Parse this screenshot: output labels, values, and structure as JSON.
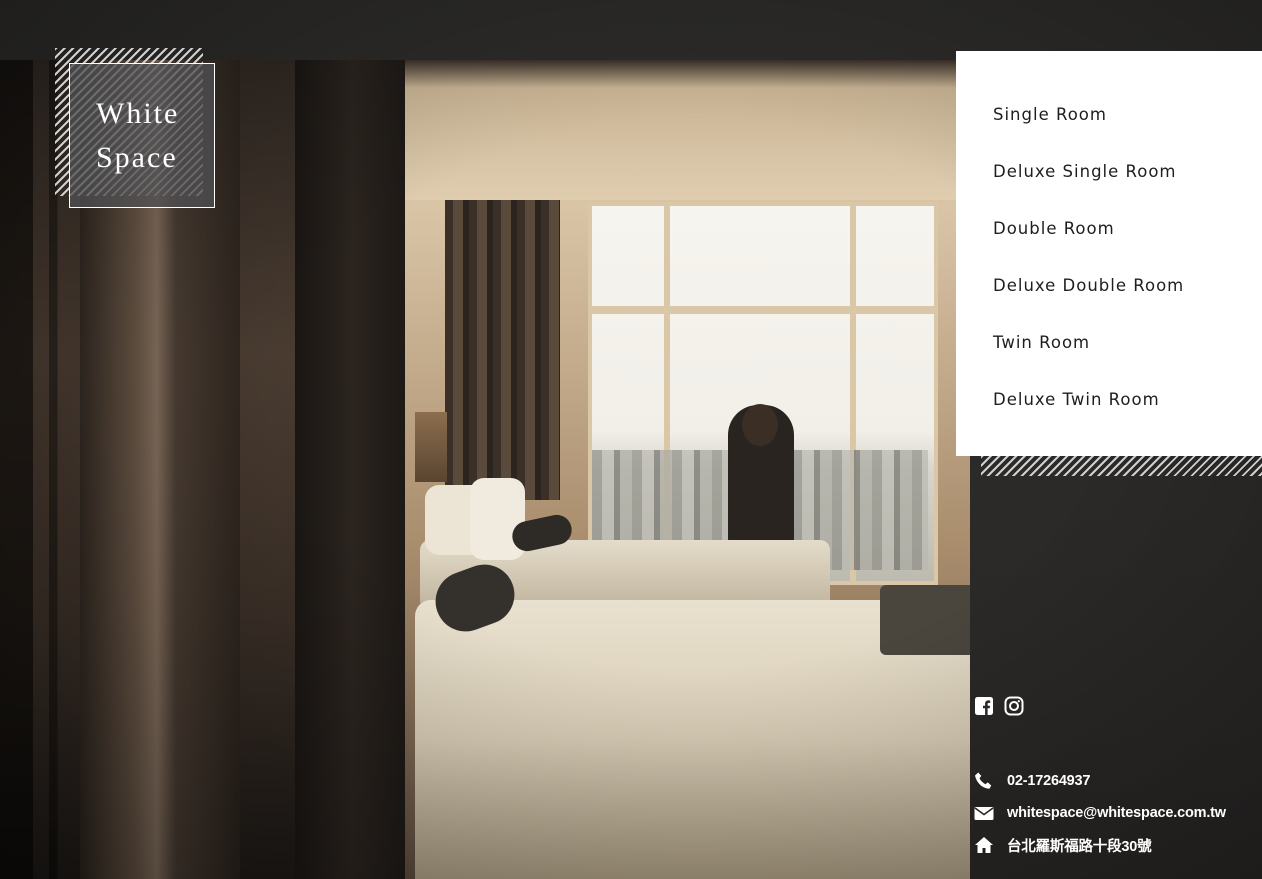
{
  "logo": {
    "line1": "White",
    "line2": "Space"
  },
  "menu": {
    "items": [
      {
        "label": "Single Room"
      },
      {
        "label": "Deluxe Single Room"
      },
      {
        "label": "Double Room"
      },
      {
        "label": "Deluxe Double Room"
      },
      {
        "label": "Twin Room"
      },
      {
        "label": "Deluxe Twin Room"
      }
    ]
  },
  "social": {
    "icons": [
      "facebook-icon",
      "instagram-icon"
    ]
  },
  "contact": {
    "phone": "02-17264937",
    "email": "whitespace@whitespace.com.tw",
    "address": "台北羅斯福路十段30號"
  },
  "colors": {
    "page_bg": "#2b2a28",
    "menu_bg": "#ffffff",
    "menu_text": "#1e1e1e",
    "contact_text": "#ffffff",
    "logo_overlay": "#505052"
  }
}
